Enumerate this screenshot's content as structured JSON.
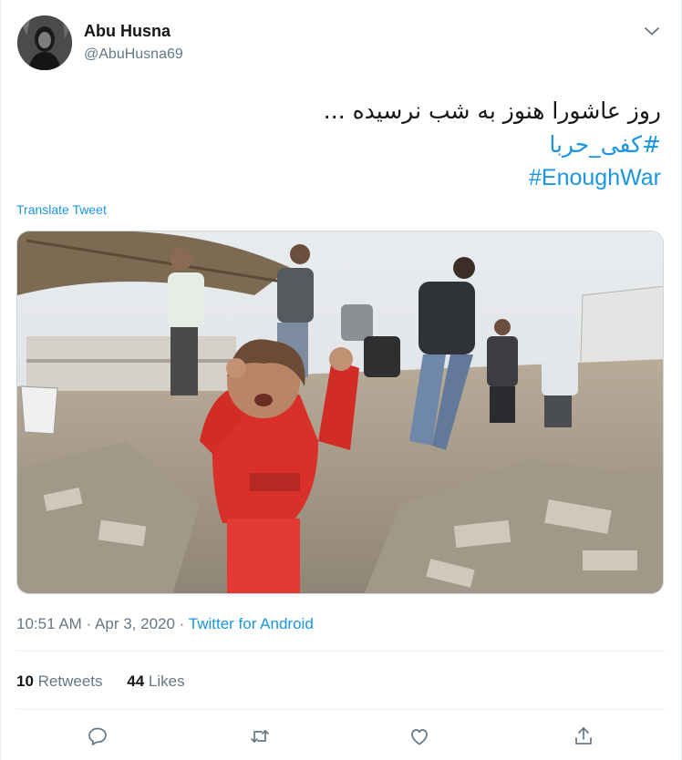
{
  "author": {
    "name": "Abu Husna",
    "handle": "@AbuHusna69"
  },
  "tweet": {
    "text_line1": "روز عاشورا هنوز به شب نرسیده ...",
    "hashtag1": "#کفی_حربا",
    "hashtag2": "#EnoughWar",
    "translate_label": "Translate Tweet"
  },
  "meta": {
    "time": "10:51 AM",
    "separator": "·",
    "date": "Apr 3, 2020",
    "source": "Twitter for Android"
  },
  "stats": {
    "retweets_count": "10",
    "retweets_label": "Retweets",
    "likes_count": "44",
    "likes_label": "Likes"
  },
  "icons": {
    "reply": "reply-icon",
    "retweet": "retweet-icon",
    "like": "like-icon",
    "share": "share-icon",
    "menu": "chevron-down-icon"
  },
  "colors": {
    "accent": "#1b95e0",
    "secondary_text": "#657786",
    "primary_text": "#14171a",
    "border": "#e6ecf0"
  }
}
